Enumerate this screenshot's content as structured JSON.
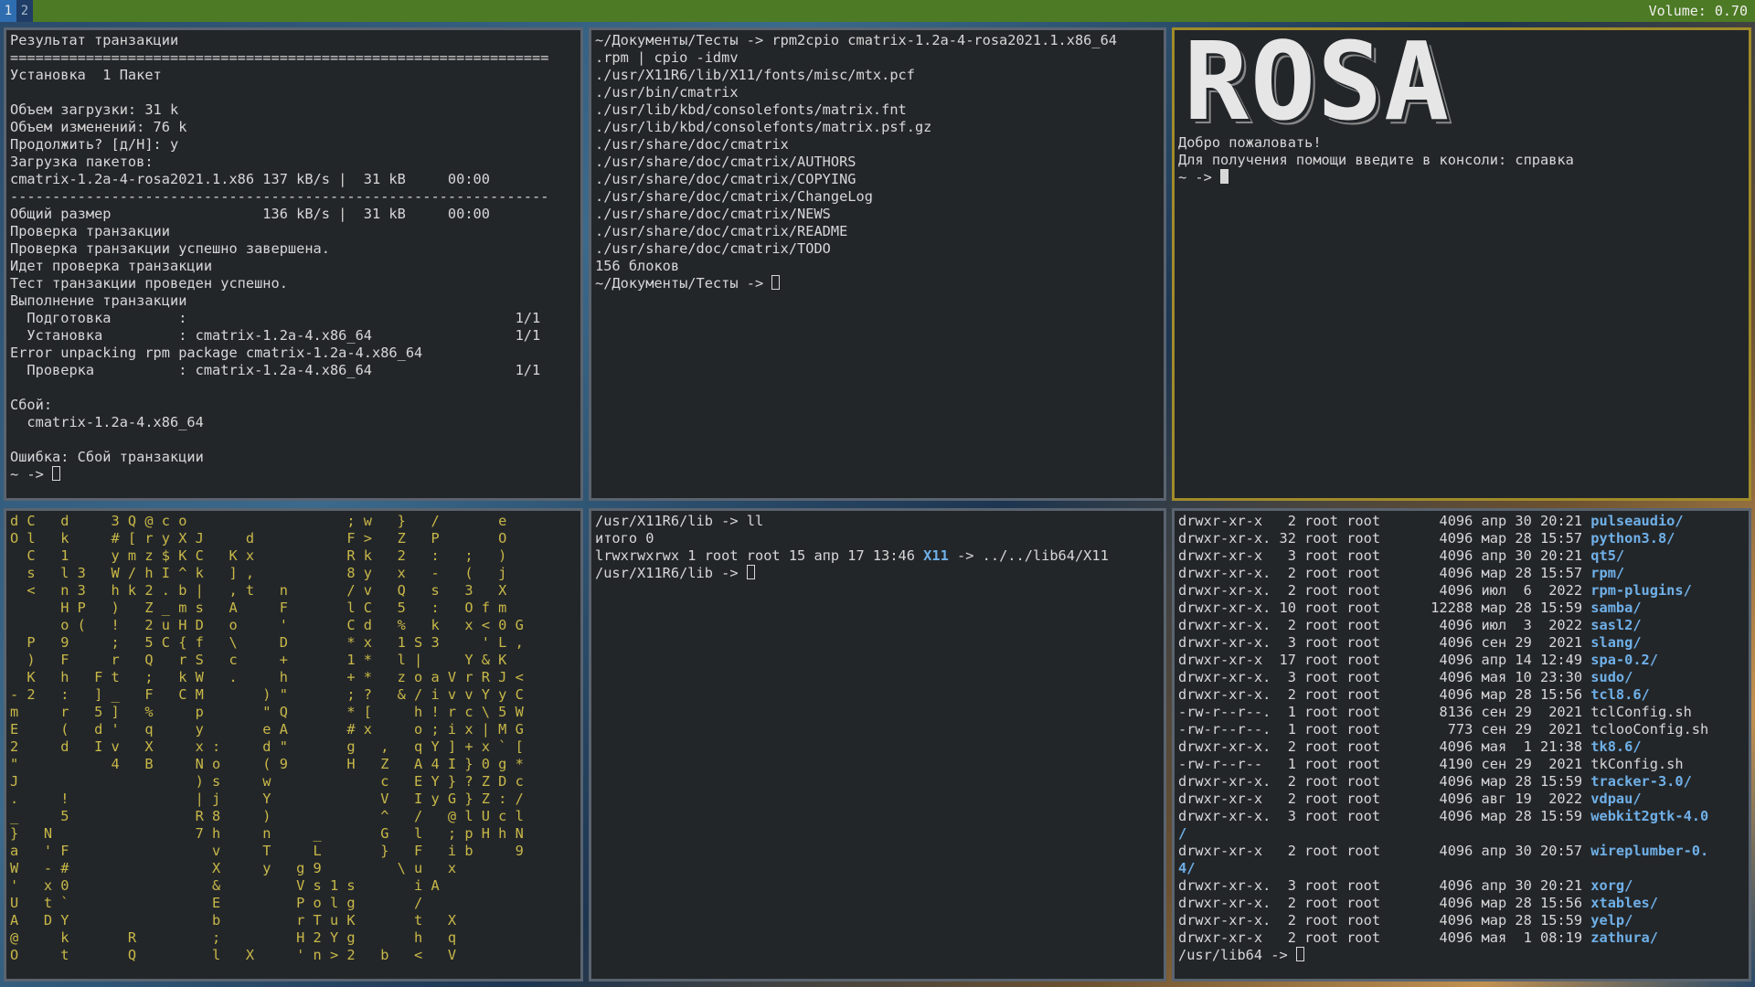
{
  "bar": {
    "workspaces": [
      "1",
      "2"
    ],
    "volume": "Volume: 0.70"
  },
  "colors": {
    "bar_bg": "#4d7a24",
    "active_ws": "#2d6db0",
    "focused_border": "#a08b2a",
    "terminal_bg": "#232629",
    "dir_color": "#6fb0e8",
    "matrix_color": "#c8b848"
  },
  "term_dnf": {
    "lines": [
      "Результат транзакции",
      "================================================================",
      "Установка  1 Пакет",
      "",
      "Объем загрузки: 31 k",
      "Объем изменений: 76 k",
      "Продолжить? [д/Н]: y",
      "Загрузка пакетов:",
      "cmatrix-1.2a-4-rosa2021.1.x86 137 kB/s |  31 kB     00:00",
      "----------------------------------------------------------------",
      "Общий размер                  136 kB/s |  31 kB     00:00",
      "Проверка транзакции",
      "Проверка транзакции успешно завершена.",
      "Идет проверка транзакции",
      "Тест транзакции проведен успешно.",
      "Выполнение транзакции",
      "  Подготовка        :                                       1/1",
      "  Установка         : cmatrix-1.2a-4.x86_64                 1/1",
      "Error unpacking rpm package cmatrix-1.2a-4.x86_64",
      "  Проверка          : cmatrix-1.2a-4.x86_64                 1/1",
      "",
      "Сбой:",
      "  cmatrix-1.2a-4.x86_64",
      "",
      "Ошибка: Сбой транзакции"
    ],
    "prompt": "~ -> "
  },
  "term_rpm2cpio": {
    "lines": [
      "~/Документы/Тесты -> rpm2cpio cmatrix-1.2a-4-rosa2021.1.x86_64",
      ".rpm | cpio -idmv",
      "./usr/X11R6/lib/X11/fonts/misc/mtx.pcf",
      "./usr/bin/cmatrix",
      "./usr/lib/kbd/consolefonts/matrix.fnt",
      "./usr/lib/kbd/consolefonts/matrix.psf.gz",
      "./usr/share/doc/cmatrix",
      "./usr/share/doc/cmatrix/AUTHORS",
      "./usr/share/doc/cmatrix/COPYING",
      "./usr/share/doc/cmatrix/ChangeLog",
      "./usr/share/doc/cmatrix/NEWS",
      "./usr/share/doc/cmatrix/README",
      "./usr/share/doc/cmatrix/TODO",
      "156 блоков"
    ],
    "prompt": "~/Документы/Тесты -> "
  },
  "term_rosa": {
    "logo_text": "ROSA",
    "lines": [
      "Добро пожаловать!",
      "Для получения помощи введите в консоли: справка"
    ],
    "prompt": "~ -> "
  },
  "term_matrix": {
    "lines": [
      "d C   d     3 Q @ c o                   ; w   }   /       e",
      "O l   k     # [ r y X J     d           F >   Z   P       O",
      "  C   1     y m z $ K C   K x           R k   2   :   ;   )",
      "  s   l 3   W / h I ^ k   ] ,           8 y   x   -   (   j",
      "  <   n 3   h k 2 . b |   , t   n       / v   Q   s   3   X",
      "      H P   )   Z _ m s   A     F       l C   5   :   O f m",
      "      o (   !   2 u H D   o     '       C d   %   k   x < 0 G",
      "  P   9     ;   5 C { f   \\     D       * x   1 S 3     ' L ,",
      "  )   F     r   Q   r S   c     +       1 *   l |     Y & K",
      "  K   h   F t   ;   k W   .     h       + *   z o a V r R J <",
      "- 2   :   ] _   F   C M       ) \"       ; ?   & / i v v Y y C",
      "m     r   5 ]   %     p       \" Q       * [     h ! r c \\ 5 W",
      "E     (   d '   q     y       e A       # x     o ; i x | M G",
      "2     d   I v   X     x :     d \"       g   ,   q Y ] + x ` [",
      "\"           4   B     N o     ( 9       H   Z   A 4 I } 0 g *",
      "J                     ) s     w             c   E Y } ? Z D c",
      ".     !               | j     Y             V   I y G } Z : /",
      "_     5               R 8     )             ^   /   @ l U c l",
      "}   N                 7 h     n     _       G   l   ; p H h N",
      "a   ' F                 v     T     L       }   F   i b     9",
      "W   - #                 X     y   g 9         \\ u   x",
      "'   x 0                 &         V s 1 s       i A",
      "U   t `                 E         P o l g       /",
      "A   D Y                 b         r T u K       t   X",
      "@     k       R         ;         H 2 Y g       h   q",
      "O     t       Q         l   X     ' n > 2   b   <   V"
    ]
  },
  "term_ll": {
    "lines": [
      "/usr/X11R6/lib -> ll",
      "итого 0"
    ],
    "link_line": {
      "prefix": "lrwxrwxrwx 1 root root 15 апр 17 13:46 ",
      "name": "X11",
      "suffix": " -> ../../lib64/X11"
    },
    "prompt": "/usr/X11R6/lib -> "
  },
  "term_lib64": {
    "entries": [
      {
        "meta": "drwxr-xr-x   2 root root       4096 апр 30 20:21 ",
        "name": "pulseaudio/",
        "dir": true
      },
      {
        "meta": "drwxr-xr-x. 32 root root       4096 мар 28 15:57 ",
        "name": "python3.8/",
        "dir": true
      },
      {
        "meta": "drwxr-xr-x   3 root root       4096 апр 30 20:21 ",
        "name": "qt5/",
        "dir": true
      },
      {
        "meta": "drwxr-xr-x.  2 root root       4096 мар 28 15:57 ",
        "name": "rpm/",
        "dir": true
      },
      {
        "meta": "drwxr-xr-x.  2 root root       4096 июл  6  2022 ",
        "name": "rpm-plugins/",
        "dir": true
      },
      {
        "meta": "drwxr-xr-x. 10 root root      12288 мар 28 15:59 ",
        "name": "samba/",
        "dir": true
      },
      {
        "meta": "drwxr-xr-x.  2 root root       4096 июл  3  2022 ",
        "name": "sasl2/",
        "dir": true
      },
      {
        "meta": "drwxr-xr-x.  3 root root       4096 сен 29  2021 ",
        "name": "slang/",
        "dir": true
      },
      {
        "meta": "drwxr-xr-x  17 root root       4096 апр 14 12:49 ",
        "name": "spa-0.2/",
        "dir": true
      },
      {
        "meta": "drwxr-xr-x.  3 root root       4096 мая 10 23:30 ",
        "name": "sudo/",
        "dir": true
      },
      {
        "meta": "drwxr-xr-x.  2 root root       4096 мар 28 15:56 ",
        "name": "tcl8.6/",
        "dir": true
      },
      {
        "meta": "-rw-r--r--.  1 root root       8136 сен 29  2021 ",
        "name": "tclConfig.sh",
        "dir": false
      },
      {
        "meta": "-rw-r--r--.  1 root root        773 сен 29  2021 ",
        "name": "tclooConfig.sh",
        "dir": false
      },
      {
        "meta": "drwxr-xr-x.  2 root root       4096 мая  1 21:38 ",
        "name": "tk8.6/",
        "dir": true
      },
      {
        "meta": "-rw-r--r--   1 root root       4190 сен 29  2021 ",
        "name": "tkConfig.sh",
        "dir": false
      },
      {
        "meta": "drwxr-xr-x.  2 root root       4096 мар 28 15:59 ",
        "name": "tracker-3.0/",
        "dir": true
      },
      {
        "meta": "drwxr-xr-x   2 root root       4096 авг 19  2022 ",
        "name": "vdpau/",
        "dir": true
      },
      {
        "meta": "drwxr-xr-x.  3 root root       4096 мар 28 15:59 ",
        "name": "webkit2gtk-4.0",
        "dir": true,
        "wrap": "/"
      },
      {
        "meta": "drwxr-xr-x   2 root root       4096 апр 30 20:57 ",
        "name": "wireplumber-0.",
        "dir": true,
        "wrap": "4/"
      },
      {
        "meta": "drwxr-xr-x.  3 root root       4096 апр 30 20:21 ",
        "name": "xorg/",
        "dir": true
      },
      {
        "meta": "drwxr-xr-x.  2 root root       4096 мар 28 15:56 ",
        "name": "xtables/",
        "dir": true
      },
      {
        "meta": "drwxr-xr-x.  2 root root       4096 мар 28 15:59 ",
        "name": "yelp/",
        "dir": true
      },
      {
        "meta": "drwxr-xr-x   2 root root       4096 мая  1 08:19 ",
        "name": "zathura/",
        "dir": true
      }
    ],
    "prompt": "/usr/lib64 -> "
  }
}
